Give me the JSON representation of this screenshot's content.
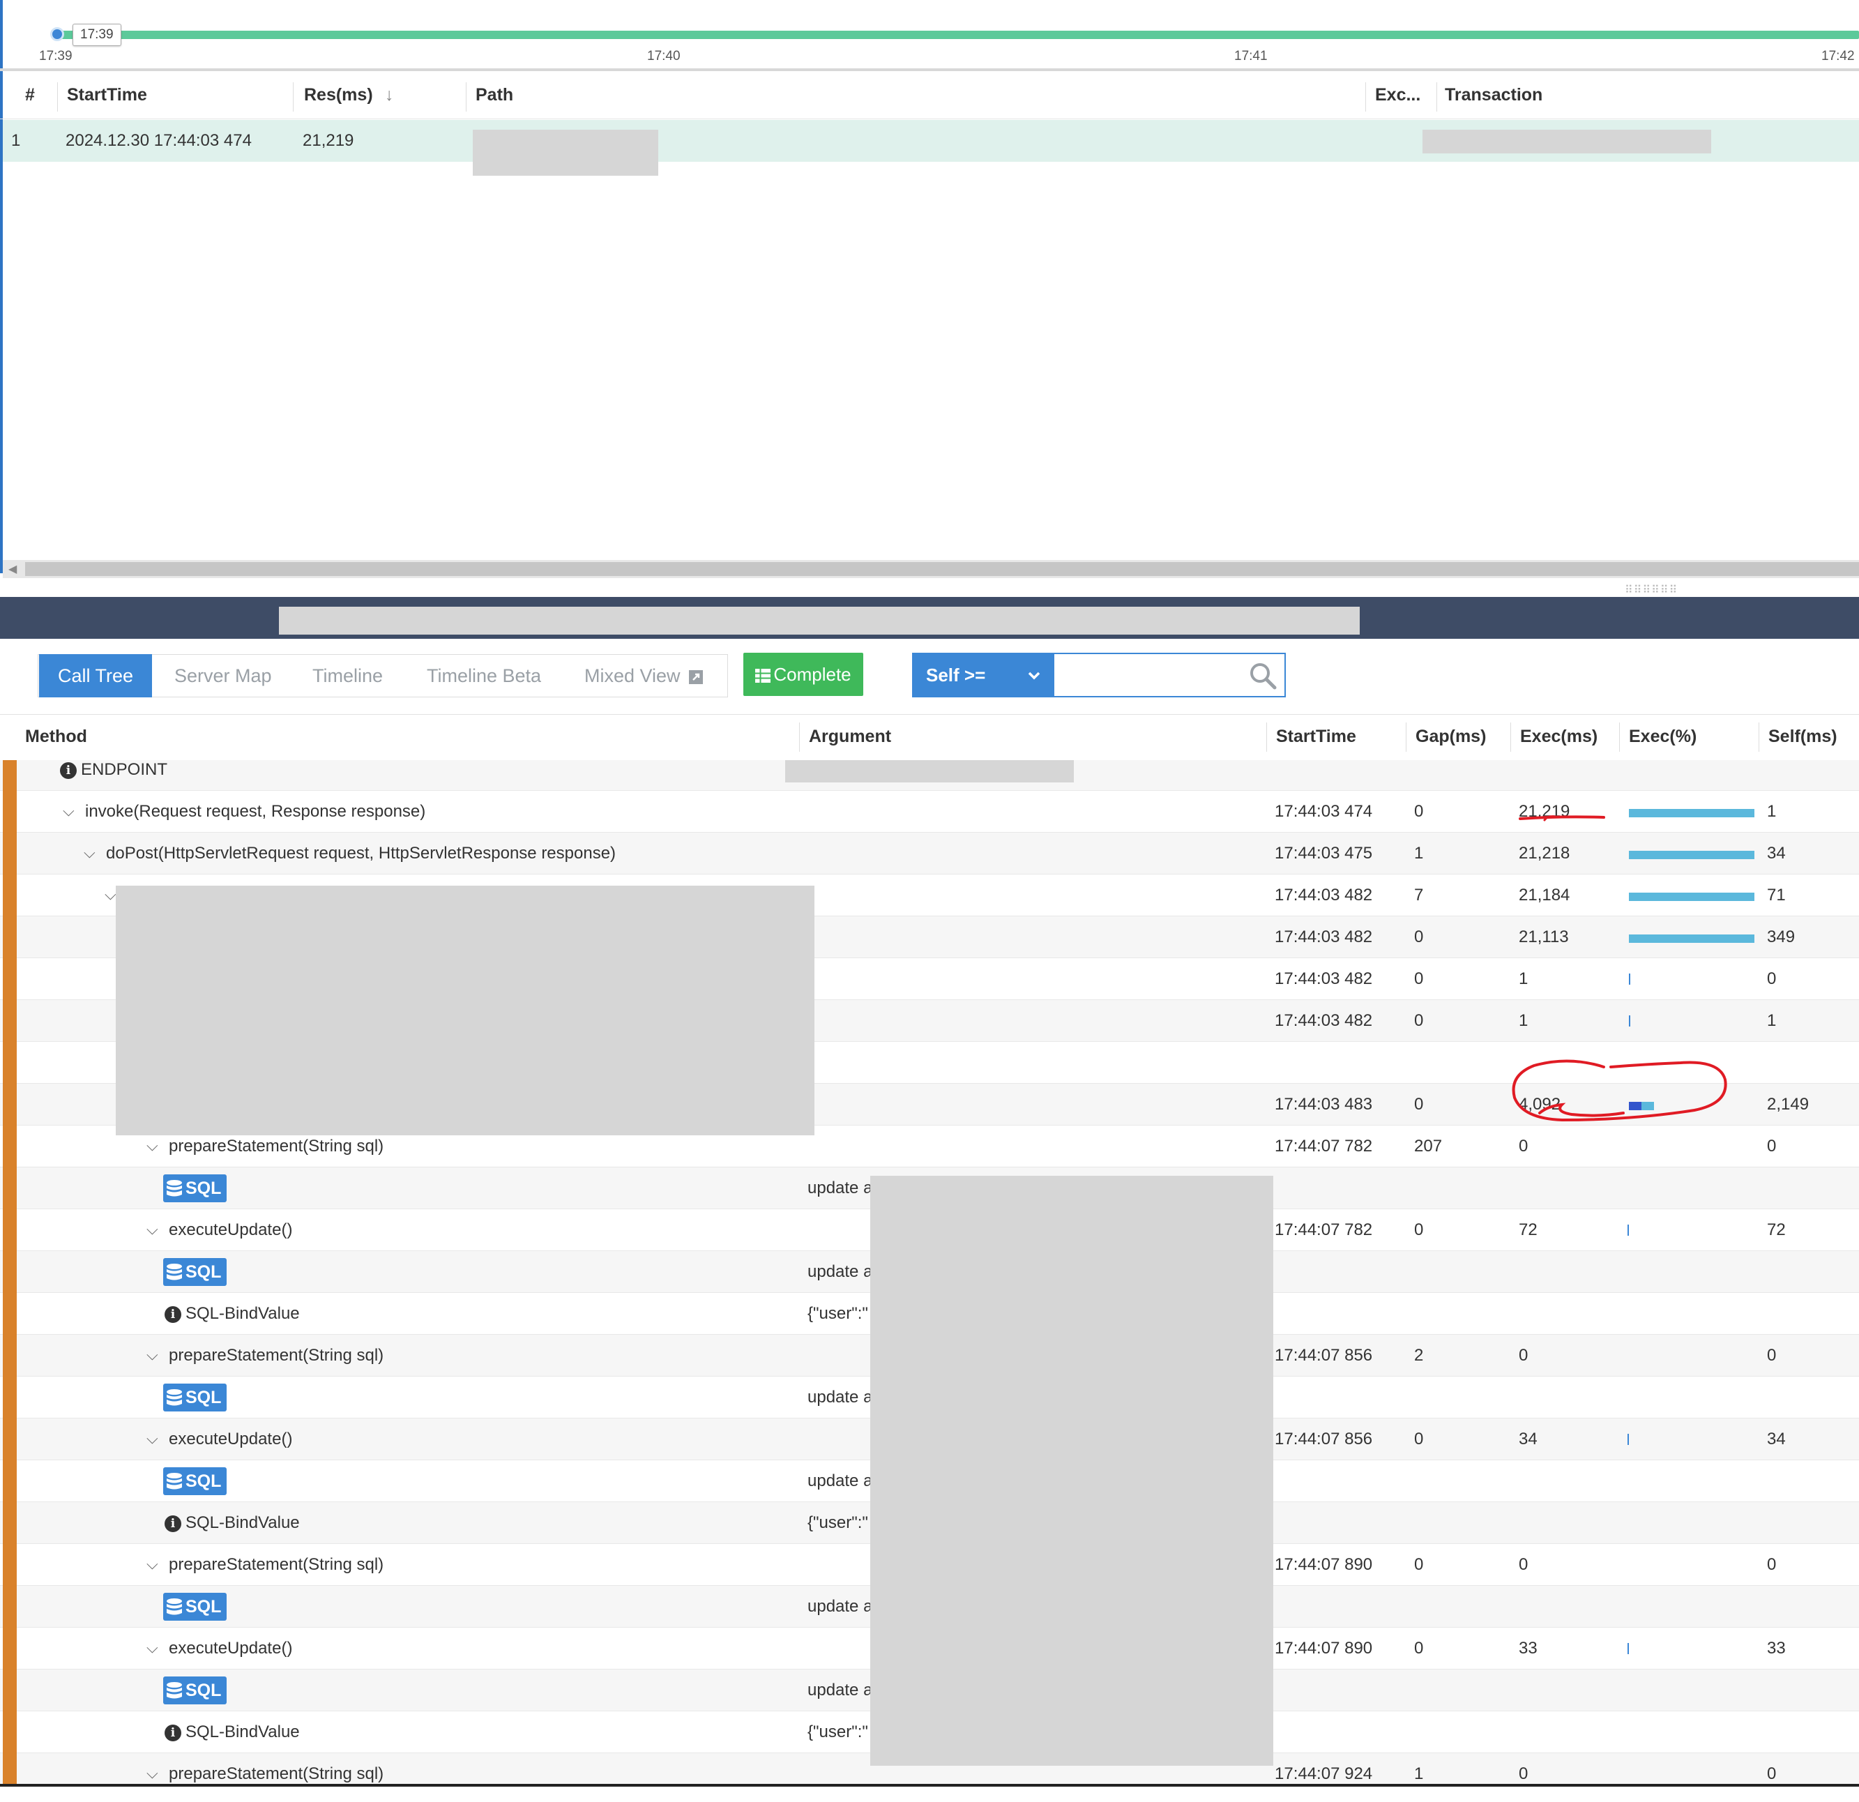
{
  "timeline": {
    "tooltip": "17:39",
    "ticks": [
      "17:39",
      "17:40",
      "17:41",
      "17:42"
    ]
  },
  "tx_list": {
    "headers": {
      "num": "#",
      "start": "StartTime",
      "res": "Res(ms)",
      "sort_icon": "↓",
      "path": "Path",
      "exc": "Exc...",
      "transaction": "Transaction"
    },
    "row": {
      "num": "1",
      "start": "2024.12.30 17:44:03 474",
      "res": "21,219"
    }
  },
  "tabs": {
    "call_tree": "Call Tree",
    "server_map": "Server Map",
    "timeline": "Timeline",
    "timeline_beta": "Timeline Beta",
    "mixed_view": "Mixed View",
    "complete": "Complete",
    "self_filter": "Self >=",
    "search_placeholder": ""
  },
  "call_tree": {
    "headers": {
      "method": "Method",
      "argument": "Argument",
      "start": "StartTime",
      "gap": "Gap(ms)",
      "exec": "Exec(ms)",
      "pct": "Exec(%)",
      "self": "Self(ms)"
    },
    "endpoint_label": "ENDPOINT",
    "rows": [
      {
        "method": "invoke(Request request, Response response)",
        "start": "17:44:03 474",
        "gap": "0",
        "exec": "21,219",
        "self": "1"
      },
      {
        "method": "doPost(HttpServletRequest request, HttpServletResponse response)",
        "start": "17:44:03 475",
        "gap": "1",
        "exec": "21,218",
        "self": "34"
      },
      {
        "method": "",
        "start": "17:44:03 482",
        "gap": "7",
        "exec": "21,184",
        "self": "71"
      },
      {
        "method": "",
        "start": "17:44:03 482",
        "gap": "0",
        "exec": "21,113",
        "self": "349"
      },
      {
        "method": "",
        "start": "17:44:03 482",
        "gap": "0",
        "exec": "1",
        "self": "0"
      },
      {
        "method": "",
        "start": "17:44:03 482",
        "gap": "0",
        "exec": "1",
        "self": "1"
      },
      {
        "method": "",
        "start": "",
        "gap": "",
        "exec": "",
        "self": ""
      },
      {
        "method": "",
        "start": "17:44:03 483",
        "gap": "0",
        "exec": "4,092",
        "self": "2,149"
      },
      {
        "method": "prepareStatement(String sql)",
        "start": "17:44:07 782",
        "gap": "207",
        "exec": "0",
        "self": "0"
      },
      {
        "badge": "SQL",
        "argument": "update a"
      },
      {
        "method": "executeUpdate()",
        "start": "17:44:07 782",
        "gap": "0",
        "exec": "72",
        "self": "72"
      },
      {
        "badge": "SQL",
        "argument": "update a"
      },
      {
        "info": "SQL-BindValue",
        "argument": "{\"user\":\""
      },
      {
        "method": "prepareStatement(String sql)",
        "start": "17:44:07 856",
        "gap": "2",
        "exec": "0",
        "self": "0"
      },
      {
        "badge": "SQL",
        "argument": "update a"
      },
      {
        "method": "executeUpdate()",
        "start": "17:44:07 856",
        "gap": "0",
        "exec": "34",
        "self": "34"
      },
      {
        "badge": "SQL",
        "argument": "update a"
      },
      {
        "info": "SQL-BindValue",
        "argument": "{\"user\":\""
      },
      {
        "method": "prepareStatement(String sql)",
        "start": "17:44:07 890",
        "gap": "0",
        "exec": "0",
        "self": "0"
      },
      {
        "badge": "SQL",
        "argument": "update a"
      },
      {
        "method": "executeUpdate()",
        "start": "17:44:07 890",
        "gap": "0",
        "exec": "33",
        "self": "33"
      },
      {
        "badge": "SQL",
        "argument": "update a"
      },
      {
        "info": "SQL-BindValue",
        "argument": "{\"user\":\""
      },
      {
        "method": "prepareStatement(String sql)",
        "start": "17:44:07 924",
        "gap": "1",
        "exec": "0",
        "self": "0"
      }
    ]
  },
  "colors": {
    "accent": "#3b87d6",
    "complete": "#3fb95a",
    "tree_bar": "#d9822b",
    "exec_bar": "#5bb8dc",
    "selected_row": "#dff1ec",
    "annotation": "#e01b24"
  }
}
